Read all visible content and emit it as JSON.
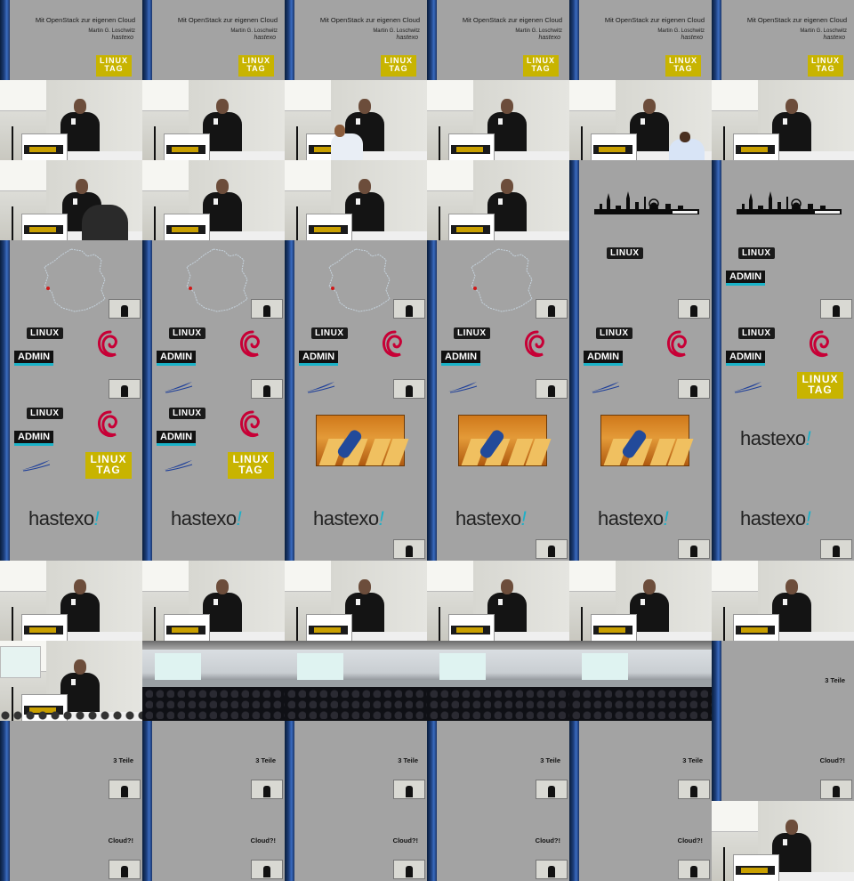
{
  "slide_text": {
    "title": "Mit OpenStack zur eigenen Cloud",
    "author": "Martin G. Loschwitz",
    "brand_small": "hastexo",
    "brand_big": "hastexo",
    "brand_bang": "!",
    "linux_tag_top": "LINUX",
    "linux_tag_bottom": "TAG",
    "linux": "LINUX",
    "admin": "ADMIN",
    "three_parts": "3 Teile",
    "cloud_q": "Cloud?!"
  },
  "colors": {
    "slide_bg": "#a3a3a3",
    "accent_blue": "#1c3d78",
    "linux_tag_yellow": "#c8b400",
    "debian_red": "#c70036",
    "hastexo_cyan": "#1db0c8"
  },
  "tiles": [
    "title",
    "title",
    "title",
    "title",
    "title",
    "title",
    "stage",
    "stage",
    "stage-guest",
    "stage",
    "stage-guest2",
    "stage",
    "stage-front",
    "stage",
    "stage",
    "stage",
    "skyline",
    "skyline",
    "map",
    "map",
    "map",
    "map",
    "linux-pip",
    "linux-admin-pip",
    "logos-pip",
    "logos-fact-pip",
    "logos-fact-pip",
    "logos-fact-pip",
    "logos-fact-pip",
    "logos-fact-lt",
    "logos-full",
    "logos-full",
    "bowling",
    "bowling",
    "bowling",
    "hastexo",
    "hastexo",
    "hastexo",
    "hastexo-pip",
    "hastexo-pip",
    "hastexo-pip",
    "hastexo-pip",
    "stage",
    "stage",
    "stage",
    "stage",
    "stage",
    "stage",
    "stage-wide",
    "auditorium",
    "auditorium",
    "auditorium",
    "auditorium",
    "teile",
    "teile-pip",
    "teile-pip",
    "teile-pip",
    "teile-pip",
    "teile-pip",
    "cloud-pip",
    "cloud-pip",
    "cloud-pip",
    "cloud-pip",
    "cloud-pip",
    "cloud-pip",
    "stage"
  ]
}
